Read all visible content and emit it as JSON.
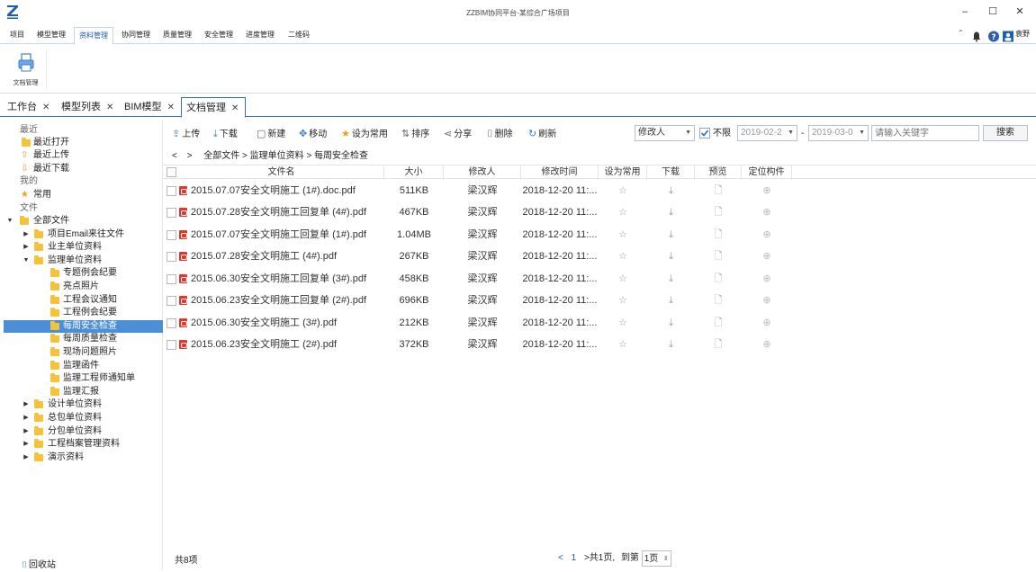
{
  "window": {
    "title": "ZZBIM协同平台-某综合广场项目",
    "controls": [
      "–",
      "☐",
      "✕"
    ]
  },
  "menu": {
    "items": [
      "项目",
      "模型管理",
      "资料管理",
      "协同管理",
      "质量管理",
      "安全管理",
      "进度管理",
      "二维码"
    ],
    "active_index": 2,
    "user": "袁野"
  },
  "ribbon": {
    "doc_manage_label": "文档管理"
  },
  "tabs": [
    {
      "label": "工作台"
    },
    {
      "label": "模型列表"
    },
    {
      "label": "BIM模型"
    },
    {
      "label": "文档管理",
      "active": true
    }
  ],
  "tree": {
    "recent_group": "最近",
    "recent_items": [
      "最近打开",
      "最近上传",
      "最近下载"
    ],
    "my_group": "我的",
    "favorite": "常用",
    "files_group": "文件",
    "all_files": "全部文件",
    "level1_before": [
      "项目Email来往文件",
      "业主单位资料"
    ],
    "supervision": "监理单位资料",
    "supervision_children": [
      "专题例会纪要",
      "亮点照片",
      "工程会议通知",
      "工程例会纪要",
      "每周安全检查",
      "每周质量检查",
      "现场问题照片",
      "监理函件",
      "监理工程师通知单",
      "监理汇报"
    ],
    "selected": "每周安全检查",
    "level1_after": [
      "设计单位资料",
      "总包单位资料",
      "分包单位资料",
      "工程档案管理资料",
      "演示资料"
    ],
    "recycle": "回收站"
  },
  "toolbar": {
    "upload": "上传",
    "download": "下载",
    "create": "新建",
    "move": "移动",
    "set_favorite": "设为常用",
    "sort": "排序",
    "share": "分享",
    "delete": "删除",
    "refresh": "刷新",
    "filter_field": "修改人",
    "unlimited_label": "不限",
    "unlimited_checked": true,
    "date_from": "2019-02-2",
    "date_to": "2019-03-0",
    "date_sep": "-",
    "keyword_placeholder": "请输入关键字",
    "search": "搜索"
  },
  "breadcrumb": [
    "全部文件",
    "监理单位资料",
    "每周安全检查"
  ],
  "table": {
    "columns": [
      "文件名",
      "大小",
      "修改人",
      "修改时间",
      "设为常用",
      "下载",
      "预览",
      "定位构件"
    ],
    "rows": [
      {
        "name": "2015.07.07安全文明施工 (1#).doc.pdf",
        "size": "511KB",
        "modifier": "梁汉辉",
        "time": "2018-12-20 11:..."
      },
      {
        "name": "2015.07.28安全文明施工回复单 (4#).pdf",
        "size": "467KB",
        "modifier": "梁汉辉",
        "time": "2018-12-20 11:..."
      },
      {
        "name": "2015.07.07安全文明施工回复单 (1#).pdf",
        "size": "1.04MB",
        "modifier": "梁汉辉",
        "time": "2018-12-20 11:..."
      },
      {
        "name": "2015.07.28安全文明施工 (4#).pdf",
        "size": "267KB",
        "modifier": "梁汉辉",
        "time": "2018-12-20 11:..."
      },
      {
        "name": "2015.06.30安全文明施工回复单 (3#).pdf",
        "size": "458KB",
        "modifier": "梁汉辉",
        "time": "2018-12-20 11:..."
      },
      {
        "name": "2015.06.23安全文明施工回复单 (2#).pdf",
        "size": "696KB",
        "modifier": "梁汉辉",
        "time": "2018-12-20 11:..."
      },
      {
        "name": "2015.06.30安全文明施工 (3#).pdf",
        "size": "212KB",
        "modifier": "梁汉辉",
        "time": "2018-12-20 11:..."
      },
      {
        "name": "2015.06.23安全文明施工 (2#).pdf",
        "size": "372KB",
        "modifier": "梁汉辉",
        "time": "2018-12-20 11:..."
      }
    ]
  },
  "footer": {
    "count": "共8项",
    "prev": "<",
    "current_page": "1",
    "next_total": ">共1页,",
    "goto_label": "到第",
    "goto_value": "1页"
  },
  "colors": {
    "accent": "#3b7fd0",
    "selected": "#4c8fd6",
    "folder": "#f5c33b",
    "pdf": "#e5362d"
  }
}
